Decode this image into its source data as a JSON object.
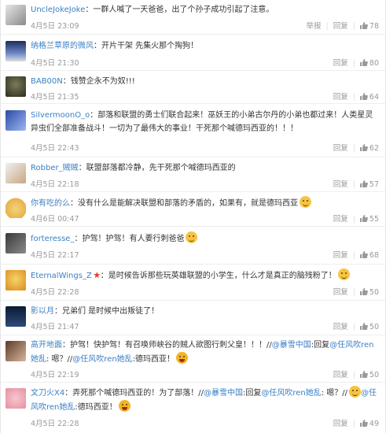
{
  "ui": {
    "reply_label": "回复",
    "report_label": "举报"
  },
  "comments": [
    {
      "user": "UncleJokeJoke",
      "text": "：一群人喊了一天爸爸，出了个孙子成功引起了注意。",
      "time": "4月5日 23:09",
      "likes": "78",
      "show_report": true
    },
    {
      "user": "纳格兰草原的微风",
      "text": "：开片干架 先集火那个掏狗！",
      "time": "4月5日 21:30",
      "likes": "80"
    },
    {
      "user": "BAB00N",
      "text": "：钱赞企永不为奴!!!",
      "time": "4月5日 21:35",
      "likes": "64"
    },
    {
      "user": "SilvermoonO_o",
      "text": "：部落和联盟的勇士们联合起来！巫妖王的小弟古尔丹的小弟也都过来！人类星灵异虫们全部准备战斗！一切为了最伟大的事业！干死那个喊德玛西亚的！！！",
      "time": "4月5日 22:43",
      "likes": "62"
    },
    {
      "user": "Robber_贼贼",
      "text": "：联盟部落都冷静，先干死那个喊德玛西亚的",
      "time": "4月5日 22:18",
      "likes": "57"
    },
    {
      "user": "你有吃的么",
      "text": "：没有什么是能解决联盟和部落的矛盾的，如果有，就是德玛西亚",
      "time": "4月6日 00:47",
      "likes": "55"
    },
    {
      "user": "forteresse_",
      "text": "：护驾！护驾！有人要行刺爸爸",
      "time": "4月5日 22:17",
      "likes": "68"
    },
    {
      "user": "EternalWings_Z",
      "text": "：是时候告诉那些玩英雄联盟的小学生，什么才是真正的脑残粉了！",
      "time": "4月5日 22:28",
      "likes": "50"
    },
    {
      "user": "影以月",
      "text": "：兄弟们 是时候中出叛徒了！",
      "time": "4月5日 21:47",
      "likes": "50"
    },
    {
      "user": "高开地面",
      "text": "：护驾！快护驾！有召唤师峡谷的贼人欲图行刺父皇！！！//",
      "at1": "@暴雪中国",
      "text2": ":回复",
      "at2": "@任风吹ren她乱",
      "text3": ": 嗯？//",
      "at3": "@任风吹ren她乱",
      "text4": ":德玛西亚！",
      "time": "4月5日 22:19",
      "likes": "50"
    },
    {
      "user": "文刀火X4",
      "text": "：弄死那个喊德玛西亚的！为了部落！//",
      "at1": "@暴雪中国",
      "text2": ":回复",
      "at2": "@任风吹ren她乱",
      "text3": ": 嗯？//",
      "at3": "@任风吹ren她乱",
      "text4": ":德玛西亚！",
      "time": "4月5日 22:28",
      "likes": "49"
    }
  ]
}
